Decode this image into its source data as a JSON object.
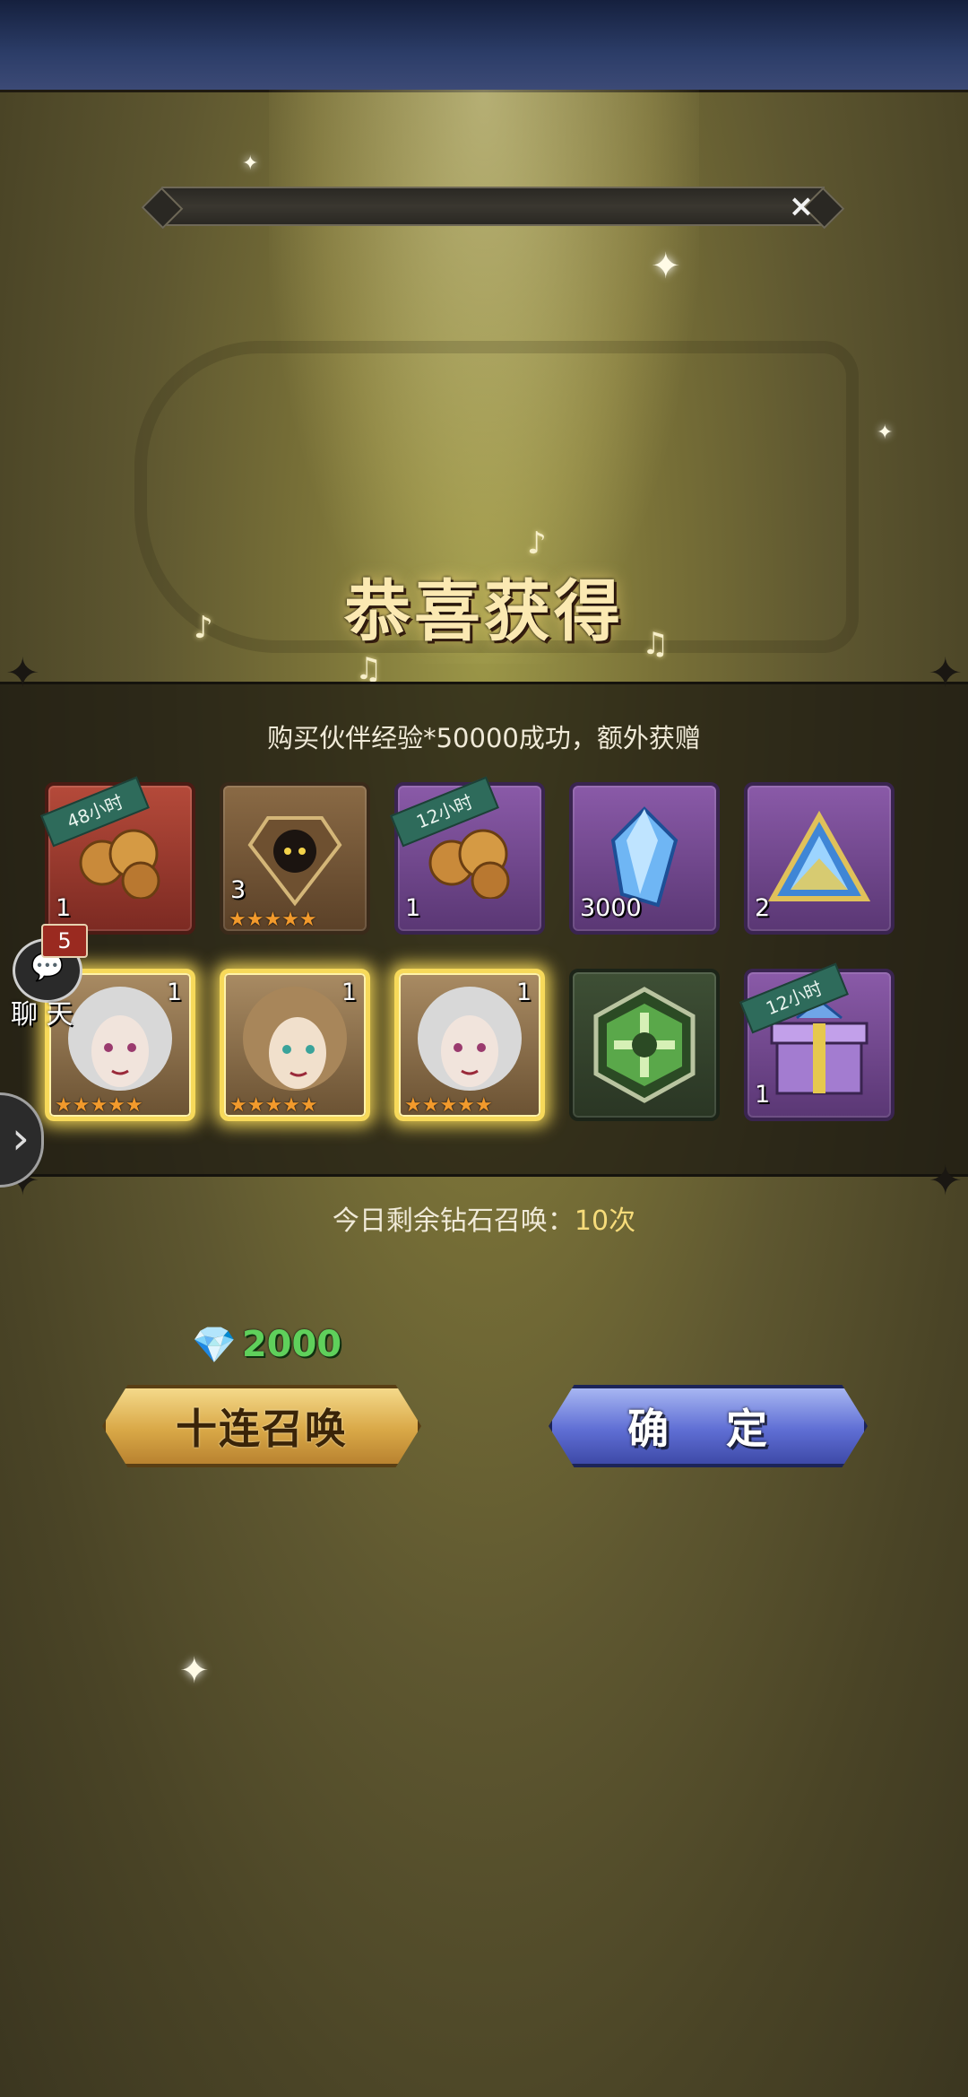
{
  "header": {
    "close_icon": "×"
  },
  "banner": {
    "title": "恭喜获得"
  },
  "panel": {
    "subtitle": "购买伙伴经验*50000成功，额外获赠"
  },
  "rewards": [
    {
      "qty": "1",
      "ribbon": "48小时",
      "icon": "bronze-roses-icon",
      "frame": "red"
    },
    {
      "qty": "3",
      "ribbon": "",
      "icon": "hooded-soul-icon",
      "frame": "brown",
      "stars": "★★★★★"
    },
    {
      "qty": "1",
      "ribbon": "12小时",
      "icon": "bronze-roses-icon",
      "frame": "purple"
    },
    {
      "qty": "3000",
      "ribbon": "",
      "icon": "blue-crystal-icon",
      "frame": "purple"
    },
    {
      "qty": "2",
      "ribbon": "",
      "icon": "triangle-gem-icon",
      "frame": "purple"
    },
    {
      "qty": "1",
      "ribbon": "",
      "icon": "hero-portrait-icon",
      "frame": "gold",
      "stars": "★★★★★"
    },
    {
      "qty": "1",
      "ribbon": "",
      "icon": "hero-portrait-icon",
      "frame": "gold",
      "stars": "★★★★★"
    },
    {
      "qty": "1",
      "ribbon": "",
      "icon": "hero-portrait-icon",
      "frame": "gold",
      "stars": "★★★★★"
    },
    {
      "qty": "",
      "ribbon": "",
      "icon": "green-emblem-icon",
      "frame": "green"
    },
    {
      "qty": "1",
      "ribbon": "12小时",
      "icon": "exp-gift-box-icon",
      "frame": "purple"
    }
  ],
  "chat": {
    "badge": "5",
    "label": "聊 天"
  },
  "remaining": {
    "label": "今日剩余钻石召唤：",
    "count": "10次"
  },
  "cost": {
    "value": "2000"
  },
  "buttons": {
    "summon": "十连召唤",
    "confirm": "确 定"
  }
}
